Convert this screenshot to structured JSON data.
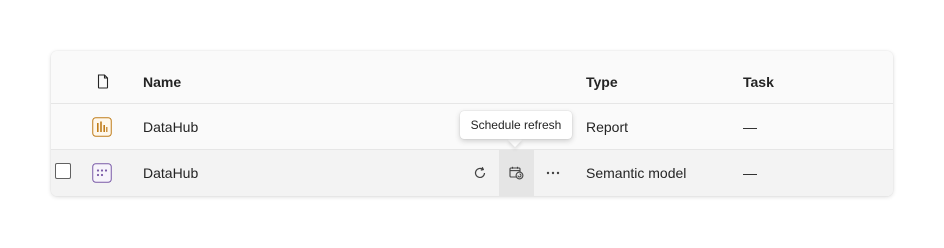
{
  "table": {
    "headers": {
      "name": "Name",
      "type": "Type",
      "task": "Task"
    },
    "rows": [
      {
        "name": "DataHub",
        "type": "Report",
        "task": "—",
        "icon": "report-icon",
        "selected_checkbox_visible": false
      },
      {
        "name": "DataHub",
        "type": "Semantic model",
        "task": "—",
        "icon": "semantic-model-icon",
        "selected_checkbox_visible": true
      }
    ]
  },
  "tooltip": {
    "text": "Schedule refresh"
  },
  "actions": {
    "refresh_icon": "refresh-icon",
    "schedule_refresh_icon": "schedule-refresh-icon",
    "more_icon": "more-options-icon"
  },
  "colors": {
    "report_icon": "#c07d1a",
    "semantic_icon": "#7a5aa8",
    "text": "#242424",
    "row_hover": "#f3f3f3",
    "active_button": "#e5e5e5"
  }
}
